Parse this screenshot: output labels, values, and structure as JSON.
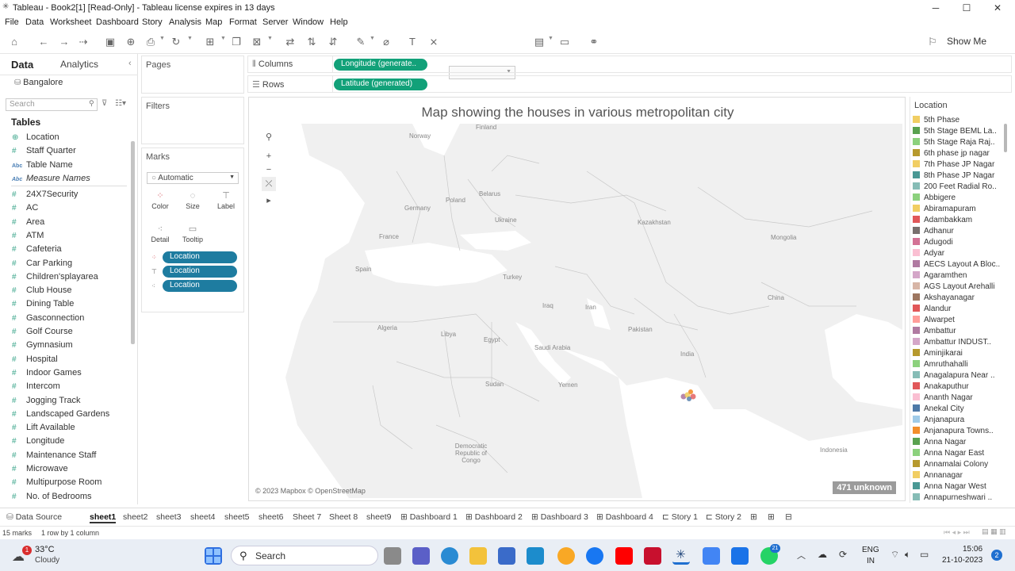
{
  "window": {
    "title": "Tableau - Book2[1] [Read-Only] - Tableau license expires in 13 days"
  },
  "menu": [
    "File",
    "Data",
    "Worksheet",
    "Dashboard",
    "Story",
    "Analysis",
    "Map",
    "Format",
    "Server",
    "Window",
    "Help"
  ],
  "toolbar": {
    "show_me": "Show Me"
  },
  "data_pane": {
    "tab_data": "Data",
    "tab_analytics": "Analytics",
    "datasource": "Bangalore",
    "search_placeholder": "Search",
    "tables_heading": "Tables",
    "fields_top": [
      {
        "label": "Location",
        "type": "geo"
      },
      {
        "label": "Staff Quarter",
        "type": "num"
      },
      {
        "label": "Table Name",
        "type": "abc"
      },
      {
        "label": "Measure Names",
        "type": "abc-it"
      }
    ],
    "fields": [
      "24X7Security",
      "AC",
      "Area",
      "ATM",
      "Cafeteria",
      "Car Parking",
      "Children'splayarea",
      "Club House",
      "Dining Table",
      "Gasconnection",
      "Golf Course",
      "Gymnasium",
      "Hospital",
      "Indoor Games",
      "Intercom",
      "Jogging Track",
      "Landscaped Gardens",
      "Lift Available",
      "Longitude",
      "Maintenance Staff",
      "Microwave",
      "Multipurpose Room",
      "No. of Bedrooms"
    ]
  },
  "cards": {
    "pages": "Pages",
    "filters": "Filters",
    "marks": "Marks",
    "mark_type": "Automatic",
    "buttons": [
      "Color",
      "Size",
      "Label",
      "Detail",
      "Tooltip"
    ],
    "pills": [
      "Location",
      "Location",
      "Location"
    ]
  },
  "shelves": {
    "columns_label": "Columns",
    "columns_pill": "Longitude (generate..",
    "rows_label": "Rows",
    "rows_pill": "Latitude (generated)"
  },
  "viz": {
    "title": "Map showing the houses in various metropolitan city",
    "attribution": "© 2023 Mapbox © OpenStreetMap",
    "unknown_badge": "471 unknown",
    "countries": [
      "Finland",
      "Norway",
      "Belarus",
      "Poland",
      "Germany",
      "Ukraine",
      "France",
      "Kazakhstan",
      "Mongolia",
      "Spain",
      "Turkey",
      "Iraq",
      "Iran",
      "China",
      "Algeria",
      "Libya",
      "Egypt",
      "Saudi Arabia",
      "Pakistan",
      "India",
      "Sudan",
      "Yemen",
      "Democratic Republic of Congo",
      "Indonesia"
    ]
  },
  "legend": {
    "title": "Location",
    "items": [
      {
        "label": "5th Phase",
        "color": "#f1ce63"
      },
      {
        "label": "5th Stage BEML La..",
        "color": "#59a14f"
      },
      {
        "label": "5th Stage Raja Raj..",
        "color": "#8cd17d"
      },
      {
        "label": "6th phase jp nagar",
        "color": "#b6992d"
      },
      {
        "label": "7th Phase JP Nagar",
        "color": "#f1ce63"
      },
      {
        "label": "8th Phase JP Nagar",
        "color": "#499894"
      },
      {
        "label": "200 Feet Radial Ro..",
        "color": "#86bcb6"
      },
      {
        "label": "Abbigere",
        "color": "#8cd17d"
      },
      {
        "label": "Abiramapuram",
        "color": "#f1ce63"
      },
      {
        "label": "Adambakkam",
        "color": "#e15759"
      },
      {
        "label": "Adhanur",
        "color": "#79706e"
      },
      {
        "label": "Adugodi",
        "color": "#d37295"
      },
      {
        "label": "Adyar",
        "color": "#fabfd2"
      },
      {
        "label": "AECS Layout A Bloc..",
        "color": "#b07aa1"
      },
      {
        "label": "Agaramthen",
        "color": "#d4a6c8"
      },
      {
        "label": "AGS Layout Arehalli",
        "color": "#d7b5a6"
      },
      {
        "label": "Akshayanagar",
        "color": "#9d7660"
      },
      {
        "label": "Alandur",
        "color": "#e15759"
      },
      {
        "label": "Alwarpet",
        "color": "#ff9d9a"
      },
      {
        "label": "Ambattur",
        "color": "#b07aa1"
      },
      {
        "label": "Ambattur INDUST..",
        "color": "#d4a6c8"
      },
      {
        "label": "Aminjikarai",
        "color": "#b6992d"
      },
      {
        "label": "Amruthahalli",
        "color": "#8cd17d"
      },
      {
        "label": "Anagalapura Near ..",
        "color": "#86bcb6"
      },
      {
        "label": "Anakaputhur",
        "color": "#e15759"
      },
      {
        "label": "Ananth Nagar",
        "color": "#fabfd2"
      },
      {
        "label": "Anekal City",
        "color": "#4e79a7"
      },
      {
        "label": "Anjanapura",
        "color": "#a0cbe8"
      },
      {
        "label": "Anjanapura Towns..",
        "color": "#f28e2b"
      },
      {
        "label": "Anna Nagar",
        "color": "#59a14f"
      },
      {
        "label": "Anna Nagar East",
        "color": "#8cd17d"
      },
      {
        "label": "Annamalai Colony",
        "color": "#b6992d"
      },
      {
        "label": "Annanagar",
        "color": "#f1ce63"
      },
      {
        "label": "Anna Nagar West",
        "color": "#499894"
      },
      {
        "label": "Annapurneshwari ..",
        "color": "#86bcb6"
      }
    ]
  },
  "tabs": {
    "datasource": "Data Source",
    "sheets": [
      "sheet1",
      "sheet2",
      "sheet3",
      "sheet4",
      "sheet5",
      "sheet6",
      "Sheet 7",
      "Sheet 8",
      "sheet9"
    ],
    "dashboards": [
      "Dashboard 1",
      "Dashboard 2",
      "Dashboard 3",
      "Dashboard 4"
    ],
    "stories": [
      "Story 1",
      "Story 2"
    ],
    "active": "sheet1"
  },
  "status": {
    "marks": "15 marks",
    "rows": "1 row by 1 column"
  },
  "taskbar": {
    "weather_temp": "33°C",
    "weather_desc": "Cloudy",
    "weather_badge": "1",
    "search": "Search",
    "lang1": "ENG",
    "lang2": "IN",
    "time": "15:06",
    "date": "21-10-2023",
    "notif": "2",
    "whatsapp_badge": "21"
  }
}
